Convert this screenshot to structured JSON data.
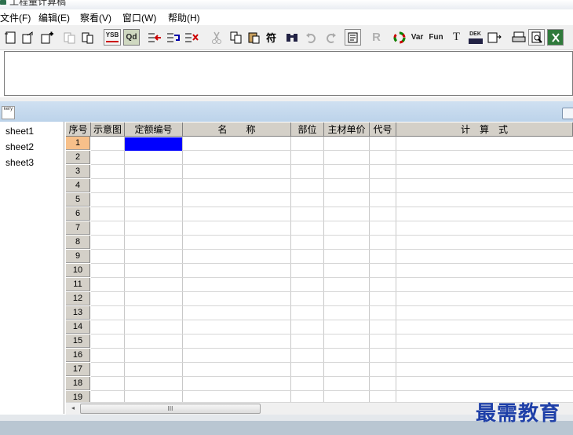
{
  "app": {
    "title": "工程量计算稿"
  },
  "menu": [
    {
      "label": "文件(F)"
    },
    {
      "label": "编辑(E)"
    },
    {
      "label": "察看(V)"
    },
    {
      "label": "窗口(W)"
    },
    {
      "label": "帮助(H)"
    }
  ],
  "toolbar": {
    "ysb_label": "YSB",
    "qd_label": "Qd",
    "r_label": "R",
    "var_label": "Var",
    "fun_label": "Fun",
    "t_label": "T",
    "dek_label": "DEK"
  },
  "child_window": {
    "icon_text": "kery"
  },
  "sheets": [
    "sheet1",
    "sheet2",
    "sheet3"
  ],
  "grid": {
    "columns": [
      "序号",
      "示意图",
      "定额编号",
      "名　　称",
      "部位",
      "主材单价",
      "代号",
      "计　算　式"
    ],
    "rows": [
      "1",
      "2",
      "3",
      "4",
      "5",
      "6",
      "7",
      "8",
      "9",
      "10",
      "11",
      "12",
      "13",
      "14",
      "15",
      "16",
      "17",
      "18",
      "19"
    ],
    "selected_row": "1"
  },
  "scrollbar": {
    "grip": "III"
  },
  "watermark": "最需教育"
}
